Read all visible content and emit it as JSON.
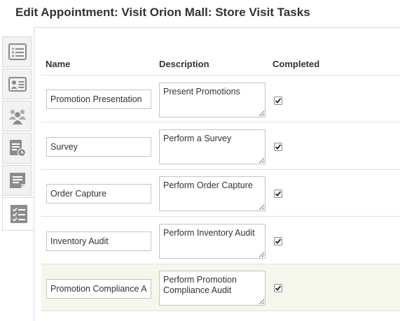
{
  "title": "Edit Appointment: Visit Orion Mall: Store Visit Tasks",
  "tabs": [
    {
      "icon": "list-details-icon",
      "active": false
    },
    {
      "icon": "contact-card-icon",
      "active": false
    },
    {
      "icon": "team-icon",
      "active": false
    },
    {
      "icon": "document-clock-icon",
      "active": false
    },
    {
      "icon": "note-icon",
      "active": false
    },
    {
      "icon": "task-checklist-icon",
      "active": true
    }
  ],
  "table": {
    "headers": {
      "name": "Name",
      "description": "Description",
      "completed": "Completed"
    },
    "rows": [
      {
        "name": "Promotion Presentation",
        "description": "Present Promotions",
        "completed": true,
        "highlight": false
      },
      {
        "name": "Survey",
        "description": "Perform a Survey",
        "completed": true,
        "highlight": false
      },
      {
        "name": "Order Capture",
        "description": "Perform Order Capture",
        "completed": true,
        "highlight": false
      },
      {
        "name": "Inventory Audit",
        "description": "Perform Inventory Audit",
        "completed": true,
        "highlight": false
      },
      {
        "name": "Promotion Compliance Audit",
        "description": "Perform Promotion Compliance Audit",
        "completed": true,
        "highlight": true
      }
    ]
  },
  "colors": {
    "tab_icon": "#8c8c8c",
    "highlight_row": "#f6f7ea"
  }
}
